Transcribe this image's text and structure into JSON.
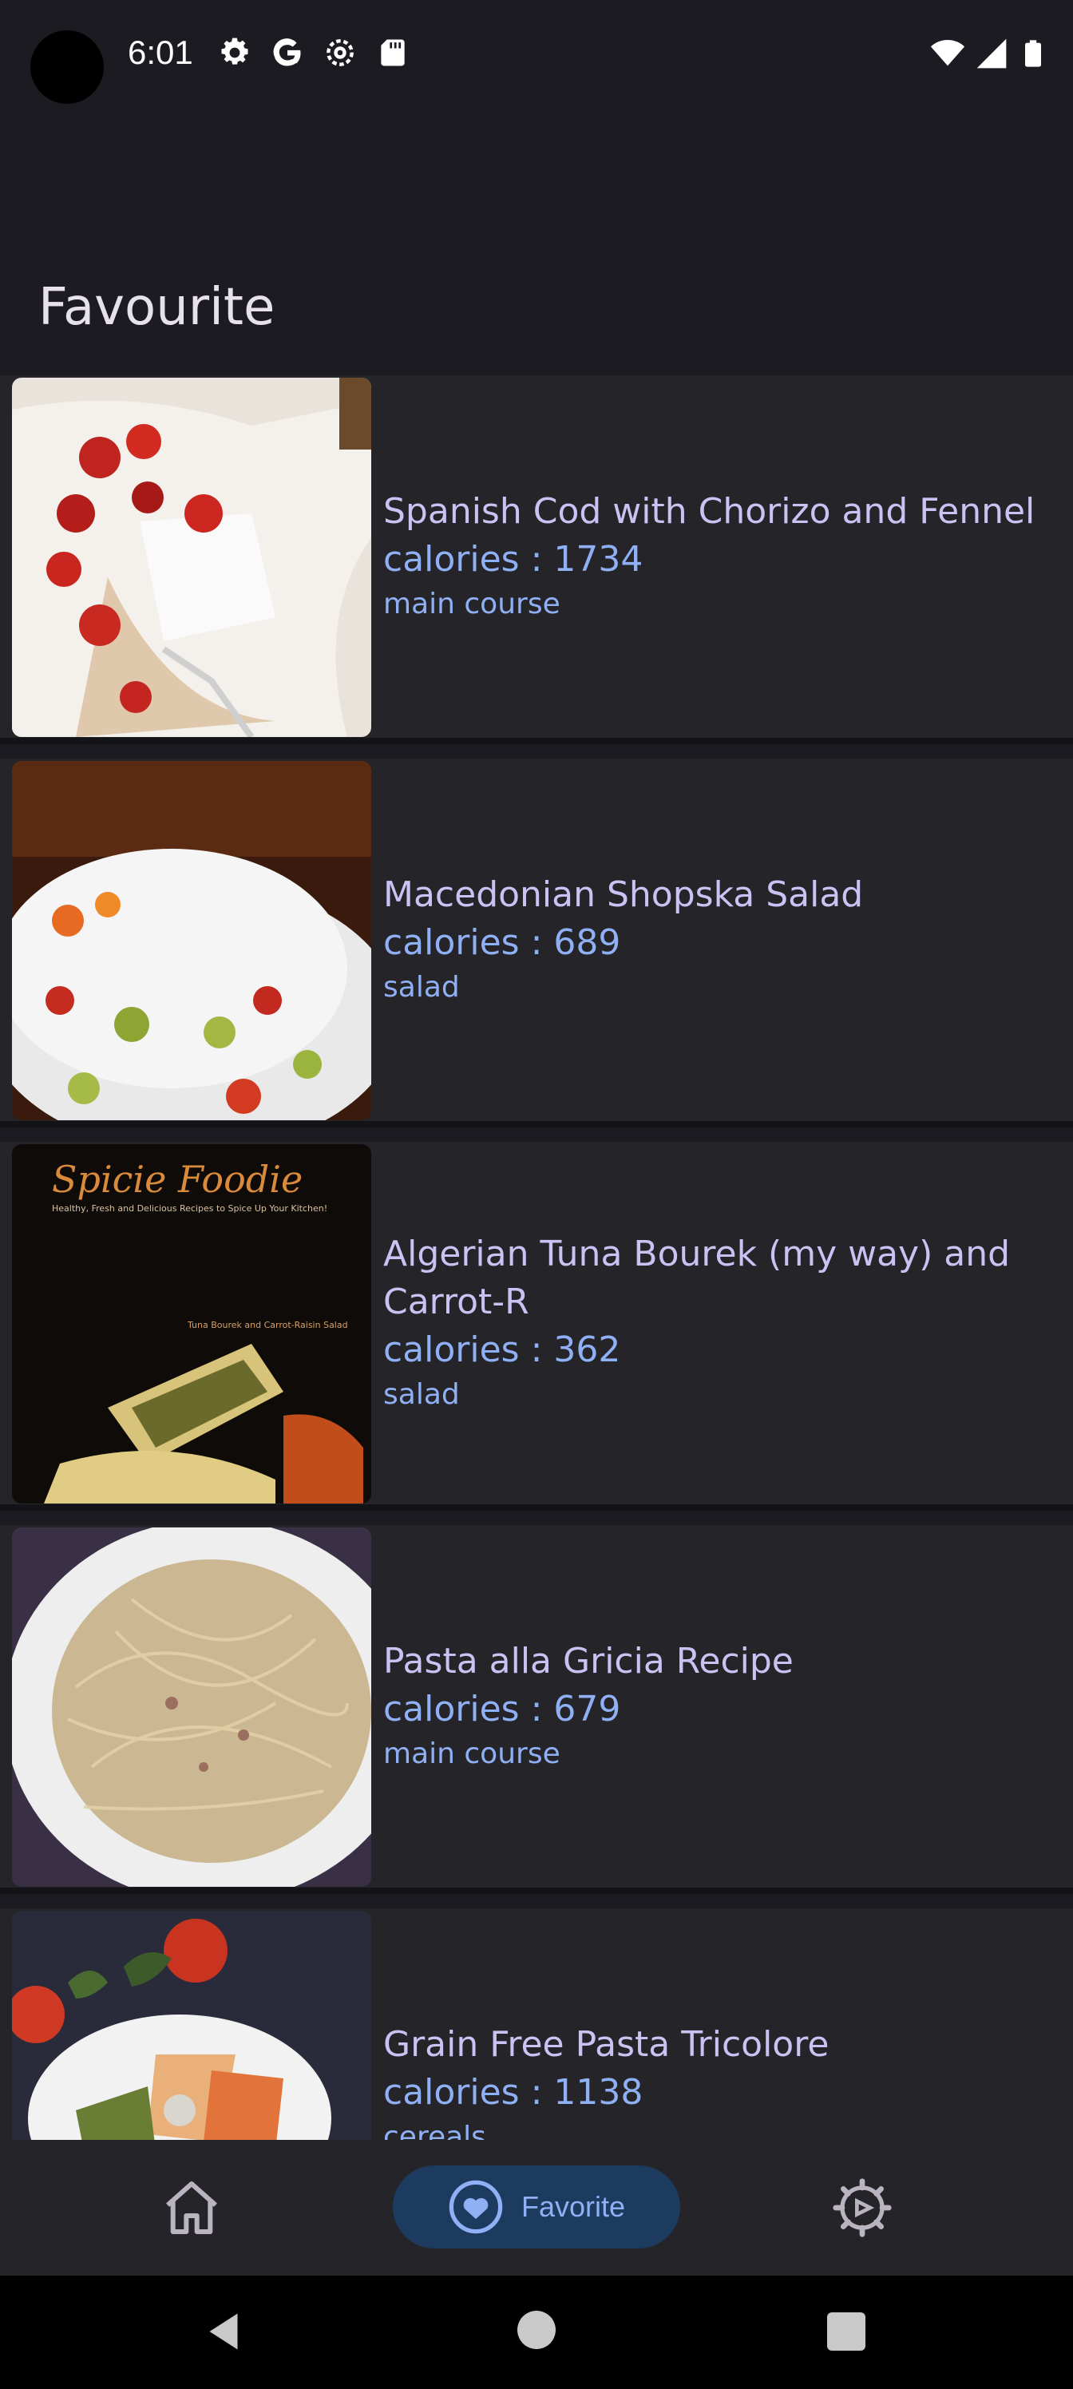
{
  "status_bar": {
    "time": "6:01",
    "icons": [
      "settings-icon",
      "google-icon",
      "settings-alt-icon",
      "sd-card-icon",
      "wifi-icon",
      "signal-icon",
      "battery-icon"
    ]
  },
  "page": {
    "title": "Favourite"
  },
  "recipes": [
    {
      "title": "Spanish Cod with Chorizo and Fennel",
      "calories": "calories : 1734",
      "category": "main course"
    },
    {
      "title": "Macedonian Shopska Salad",
      "calories": "calories : 689",
      "category": "salad"
    },
    {
      "title": "Algerian Tuna Bourek (my way) and Carrot-R",
      "calories": "calories : 362",
      "category": "salad"
    },
    {
      "title": "Pasta alla Gricia Recipe",
      "calories": "calories : 679",
      "category": "main course"
    },
    {
      "title": "Grain Free Pasta Tricolore",
      "calories": "calories : 1138",
      "category": "cereals"
    }
  ],
  "bottom_nav": {
    "home_icon": "home-icon",
    "favorite_label": "Favorite",
    "favorite_icon": "heart-icon",
    "settings_icon": "settings-icon"
  },
  "colors": {
    "background": "#1c1b21",
    "card": "#252428",
    "title": "#c9c2f2",
    "accent": "#8fb0f5",
    "nav_pill": "#1d3a5f"
  }
}
